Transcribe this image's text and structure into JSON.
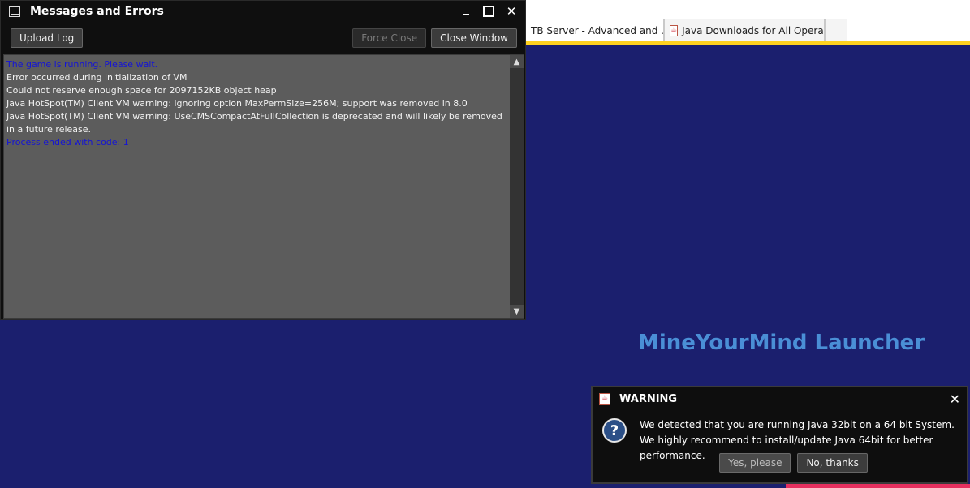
{
  "browser": {
    "tabs": [
      {
        "label": "TB Server - Advanced and ...",
        "close": "✕"
      },
      {
        "label": "Java Downloads for All Operati...",
        "icon": "java-icon"
      },
      {
        "label": ""
      }
    ]
  },
  "launcher": {
    "title": "MineYourMind Launcher"
  },
  "messages_window": {
    "title": "Messages and Errors",
    "buttons": {
      "upload_log": "Upload Log",
      "force_close": "Force Close",
      "close_window": "Close Window"
    },
    "log_lines": [
      {
        "text": "The game is running. Please wait.",
        "type": "info"
      },
      {
        "text": "Error occurred during initialization of VM",
        "type": "normal"
      },
      {
        "text": "Could not reserve enough space for 2097152KB object heap",
        "type": "normal"
      },
      {
        "text": "Java HotSpot(TM) Client VM warning: ignoring option MaxPermSize=256M; support was removed in 8.0",
        "type": "normal"
      },
      {
        "text": "Java HotSpot(TM) Client VM warning: UseCMSCompactAtFullCollection is deprecated and will likely be removed in a future release.",
        "type": "normal"
      },
      {
        "text": "Process ended with code: 1",
        "type": "info"
      }
    ]
  },
  "warning_dialog": {
    "title": "WARNING",
    "message_line1": "We detected that you are running Java 32bit on a 64 bit System.",
    "message_line2": "We highly recommend to install/update Java 64bit for better performance.",
    "yes_button": "Yes, please",
    "no_button": "No, thanks"
  },
  "colors": {
    "background": "#1b1f6e",
    "info_text": "#1414d6",
    "launcher_title": "#4a8fd6",
    "accent_yellow": "#ffd21f"
  }
}
